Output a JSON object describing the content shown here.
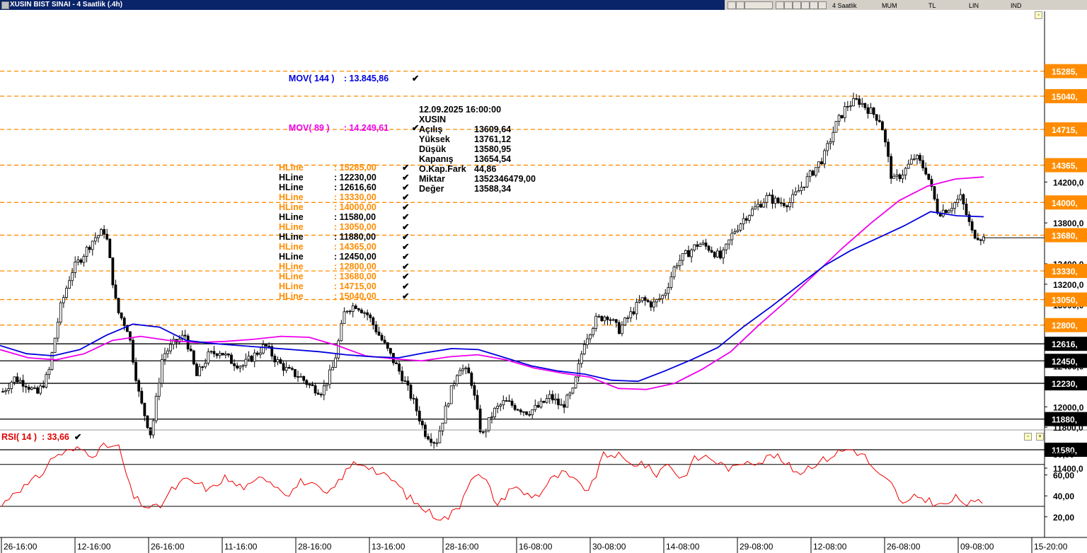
{
  "window": {
    "title": "XUSIN BIST SINAI - 4 Saatlik (.4h)",
    "toolbar": [
      "4 Saatlik",
      "MUM",
      "TL",
      "LIN",
      "IND"
    ]
  },
  "legend": {
    "mov144": {
      "label": "MOV( 144 )",
      "value": ": 13.845,86",
      "color": "#0000dd"
    },
    "mov89": {
      "label": "MOV( 89 )",
      "value": ": 14.249,61",
      "color": "#ee00ee"
    },
    "hlines": [
      {
        "label": "HLine",
        "value": ": 15285,00",
        "color": "#ff8c00"
      },
      {
        "label": "HLine",
        "value": ": 12230,00",
        "color": "#000000"
      },
      {
        "label": "HLine",
        "value": ": 12616,60",
        "color": "#000000"
      },
      {
        "label": "HLine",
        "value": ": 13330,00",
        "color": "#ff8c00"
      },
      {
        "label": "HLine",
        "value": ": 14000,00",
        "color": "#ff8c00"
      },
      {
        "label": "HLine",
        "value": ": 11580,00",
        "color": "#000000"
      },
      {
        "label": "HLine",
        "value": ": 13050,00",
        "color": "#ff8c00"
      },
      {
        "label": "HLine",
        "value": ": 11880,00",
        "color": "#000000"
      },
      {
        "label": "HLine",
        "value": ": 14365,00",
        "color": "#ff8c00"
      },
      {
        "label": "HLine",
        "value": ": 12450,00",
        "color": "#000000"
      },
      {
        "label": "HLine",
        "value": ": 12800,00",
        "color": "#ff8c00"
      },
      {
        "label": "HLine",
        "value": ": 13680,00",
        "color": "#ff8c00"
      },
      {
        "label": "HLine",
        "value": ": 14715,00",
        "color": "#ff8c00"
      },
      {
        "label": "HLine",
        "value": ": 15040,00",
        "color": "#ff8c00"
      }
    ]
  },
  "info": {
    "datetime": "12.09.2025  16:00:00",
    "symbol": "XUSIN",
    "rows": [
      {
        "k": "Açılış",
        "v": "13609,64"
      },
      {
        "k": "Yüksek",
        "v": "13761,12"
      },
      {
        "k": "Düşük",
        "v": "13580,95"
      },
      {
        "k": "Kapanış",
        "v": "13654,54"
      },
      {
        "k": "O.Kap.Fark",
        "v": "44,86"
      },
      {
        "k": "Miktar",
        "v": "1352346479,00"
      },
      {
        "k": "Değer",
        "v": "13588,34"
      }
    ]
  },
  "rsi": {
    "label": "RSI( 14 )",
    "value": ": 33,66",
    "color": "#ee0000"
  },
  "chart_data": [
    {
      "type": "candlestick",
      "title": "XUSIN BIST SINAI - 4 Saatlik (.4h)",
      "x_tick_labels": [
        "26-16:00",
        "12-16:00",
        "26-16:00",
        "11-16:00",
        "28-16:00",
        "13-16:00",
        "28-16:00",
        "16-08:00",
        "30-08:00",
        "14-08:00",
        "29-08:00",
        "12-08:00",
        "26-08:00",
        "09-08:00",
        "15-20:00"
      ],
      "y_tick_labels": [
        "14200,0",
        "13800,0",
        "13400,0",
        "13200,0",
        "13000,0",
        "12400,0",
        "12000,0",
        "11800,0",
        "11400,0"
      ],
      "ylim": [
        11300,
        15400
      ],
      "close_path": [
        12150,
        12280,
        12230,
        12120,
        12320,
        12950,
        13320,
        13480,
        13650,
        13730,
        12950,
        12750,
        12080,
        11720,
        12500,
        12620,
        12700,
        12300,
        12500,
        12550,
        12450,
        12400,
        12500,
        12600,
        12450,
        12350,
        12300,
        12200,
        12150,
        12400,
        12950,
        13000,
        12900,
        12700,
        12500,
        12300,
        12050,
        11750,
        11650,
        12050,
        12400,
        12300,
        11700,
        11950,
        12050,
        12000,
        11950,
        12000,
        12100,
        12000,
        12150,
        12650,
        12850,
        12900,
        12750,
        12900,
        13050,
        13000,
        13100,
        13400,
        13500,
        13600,
        13550,
        13450,
        13700,
        13850,
        13950,
        14050,
        14000,
        14000,
        14150,
        14300,
        14450,
        14750,
        14950,
        15000,
        14900,
        14800,
        14200,
        14300,
        14450,
        14300,
        13900,
        13950,
        14050,
        13700,
        13650
      ],
      "hlines": [
        {
          "value": 15285,
          "label": "15285,",
          "color": "#ff8c00",
          "dashed": true
        },
        {
          "value": 15040,
          "label": "15040,",
          "color": "#ff8c00",
          "dashed": true
        },
        {
          "value": 14715,
          "label": "14715,",
          "color": "#ff8c00",
          "dashed": true
        },
        {
          "value": 14365,
          "label": "14365,",
          "color": "#ff8c00",
          "dashed": true
        },
        {
          "value": 14000,
          "label": "14000,",
          "color": "#ff8c00",
          "dashed": true
        },
        {
          "value": 13680,
          "label": "13680,",
          "color": "#ff8c00",
          "dashed": true
        },
        {
          "value": 13330,
          "label": "13330,",
          "color": "#ff8c00",
          "dashed": true
        },
        {
          "value": 13050,
          "label": "13050,",
          "color": "#ff8c00",
          "dashed": true
        },
        {
          "value": 12800,
          "label": "12800,",
          "color": "#ff8c00",
          "dashed": true
        },
        {
          "value": 12616.6,
          "label": "12616,",
          "color": "#000000",
          "dashed": false
        },
        {
          "value": 12450,
          "label": "12450,",
          "color": "#000000",
          "dashed": false
        },
        {
          "value": 12230,
          "label": "12230,",
          "color": "#000000",
          "dashed": false
        },
        {
          "value": 11880,
          "label": "11880,",
          "color": "#000000",
          "dashed": false
        },
        {
          "value": 11580,
          "label": "11580,",
          "color": "#000000",
          "dashed": false
        }
      ],
      "mov144_path": [
        12600,
        12520,
        12500,
        12560,
        12700,
        12810,
        12780,
        12650,
        12620,
        12600,
        12580,
        12560,
        12540,
        12510,
        12490,
        12480,
        12530,
        12570,
        12560,
        12480,
        12400,
        12350,
        12320,
        12260,
        12250,
        12350,
        12460,
        12580,
        12790,
        12980,
        13180,
        13380,
        13530,
        13650,
        13770,
        13910,
        13870,
        13860
      ],
      "mov89_path": [
        12560,
        12480,
        12460,
        12520,
        12650,
        12690,
        12650,
        12630,
        12640,
        12660,
        12690,
        12680,
        12600,
        12500,
        12470,
        12450,
        12490,
        12510,
        12460,
        12380,
        12330,
        12290,
        12180,
        12170,
        12230,
        12370,
        12540,
        12800,
        13040,
        13300,
        13560,
        13800,
        14020,
        14160,
        14230,
        14250
      ]
    },
    {
      "type": "line",
      "title": "RSI( 14 )",
      "y_tick_labels": [
        "80,00",
        "60,00",
        "40,00",
        "20,00"
      ],
      "ylim": [
        10,
        92
      ],
      "hlines": [
        70,
        30
      ],
      "series": [
        {
          "name": "RSI( 14 )",
          "values": [
            30,
            45,
            50,
            60,
            78,
            82,
            85,
            80,
            88,
            86,
            40,
            30,
            28,
            45,
            55,
            52,
            45,
            58,
            50,
            48,
            60,
            50,
            42,
            55,
            48,
            40,
            58,
            72,
            70,
            60,
            55,
            40,
            30,
            22,
            18,
            30,
            62,
            55,
            30,
            50,
            42,
            40,
            55,
            62,
            52,
            45,
            78,
            80,
            70,
            72,
            60,
            72,
            55,
            75,
            78,
            70,
            65,
            75,
            72,
            80,
            70,
            62,
            70,
            75,
            82,
            85,
            78,
            60,
            52,
            30,
            40,
            35,
            30,
            38,
            32,
            34
          ]
        }
      ]
    }
  ]
}
